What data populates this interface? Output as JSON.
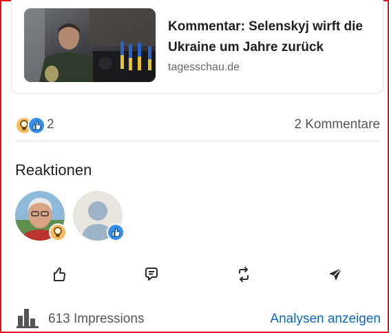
{
  "link_preview": {
    "title": "Kommentar: Selenskyj wirft die Ukraine um Jahre zurück",
    "domain": "tagesschau.de"
  },
  "social": {
    "reaction_count": "2",
    "comments_label": "2 Kommentare",
    "reaction_icons": [
      "insightful-lightbulb-icon",
      "like-thumb-icon"
    ]
  },
  "reactions": {
    "title": "Reaktionen"
  },
  "actions": [
    {
      "icon": "like-icon"
    },
    {
      "icon": "comment-icon"
    },
    {
      "icon": "repost-icon"
    },
    {
      "icon": "send-icon"
    }
  ],
  "footer": {
    "impressions_label": "613 Impressions",
    "analytics_label": "Analysen anzeigen"
  },
  "colors": {
    "border_accent": "#e8101b",
    "link_blue": "#0a66c2",
    "like_blue": "#378fe9",
    "insight_gold": "#f5bb5c"
  }
}
